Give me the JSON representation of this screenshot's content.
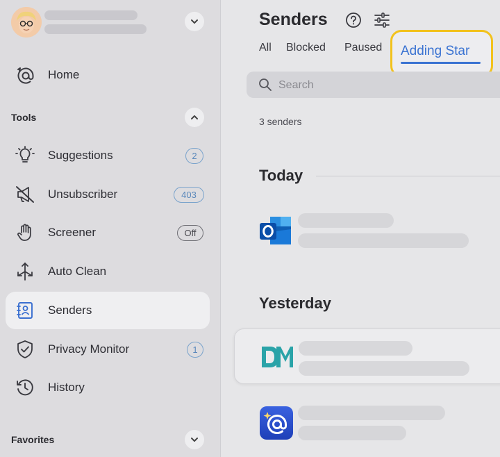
{
  "sidebar": {
    "nav": [
      {
        "label": "Home",
        "icon": "at-icon"
      },
      {
        "label": "Suggestions",
        "icon": "lightbulb-icon",
        "badge": "2"
      },
      {
        "label": "Unsubscriber",
        "icon": "muted-megaphone-icon",
        "badge": "403"
      },
      {
        "label": "Screener",
        "icon": "hand-icon",
        "badge": "Off"
      },
      {
        "label": "Auto Clean",
        "icon": "arrows-icon"
      },
      {
        "label": "Senders",
        "icon": "contact-book-icon"
      },
      {
        "label": "Privacy Monitor",
        "icon": "shield-check-icon",
        "badge": "1"
      },
      {
        "label": "History",
        "icon": "clock-history-icon"
      }
    ],
    "sections": {
      "tools": "Tools",
      "favorites": "Favorites"
    }
  },
  "main": {
    "title": "Senders",
    "tabs": [
      "All",
      "Blocked",
      "Paused",
      "Adding Star"
    ],
    "active_tab": "Adding Star",
    "search_placeholder": "Search",
    "count": "3 senders",
    "groups": [
      "Today",
      "Yesterday"
    ]
  },
  "colors": {
    "accent": "#3a73d2",
    "highlight": "#f2c21d",
    "sidebar_bg": "#dddcdf"
  }
}
